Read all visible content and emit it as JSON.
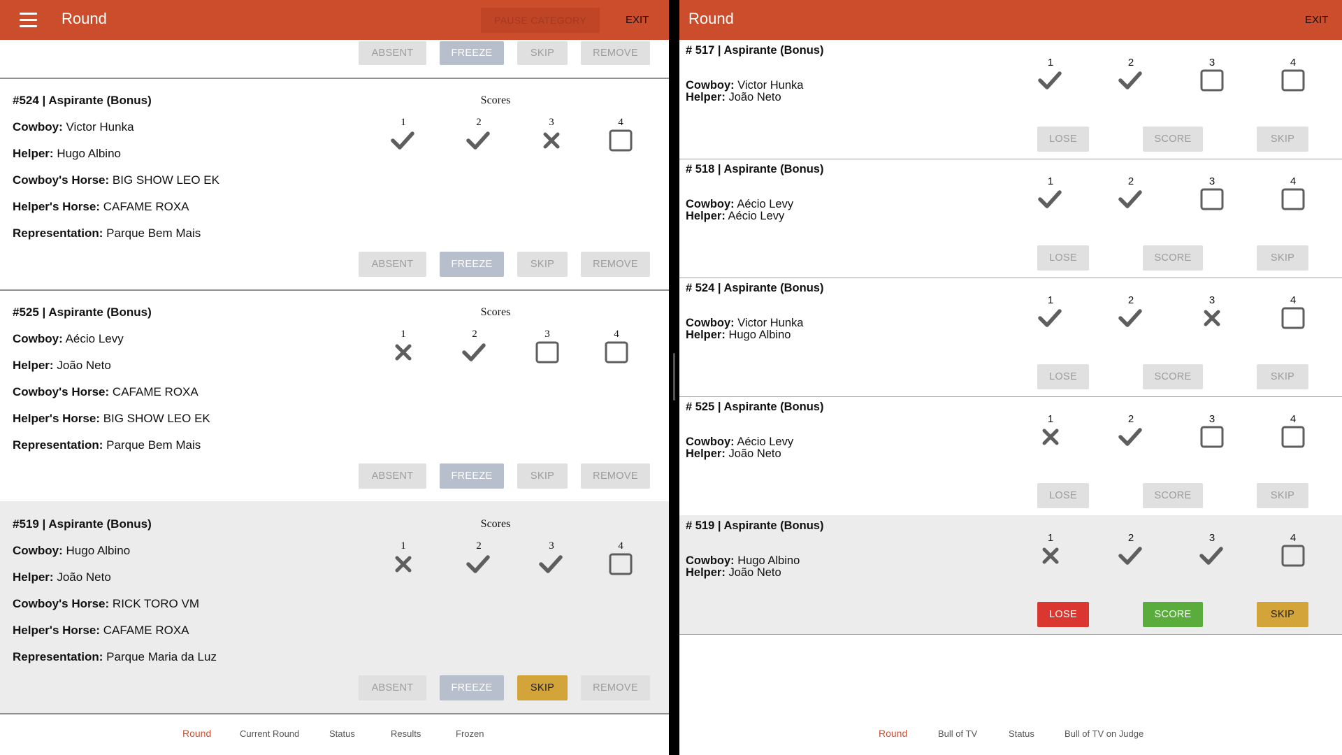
{
  "left": {
    "header": {
      "title": "Round",
      "pause_label": "PAUSE CATEGORY",
      "exit_label": "EXIT"
    },
    "top_actions": [
      "ABSENT",
      "FREEZE",
      "SKIP",
      "REMOVE"
    ],
    "scores_label": "Scores",
    "cards": [
      {
        "title": "#524 | Aspirante (Bonus)",
        "rows": [
          {
            "label": "Cowboy:",
            "value": "Victor Hunka"
          },
          {
            "label": "Helper:",
            "value": "Hugo Albino"
          },
          {
            "label": "Cowboy's Horse:",
            "value": "BIG SHOW LEO EK"
          },
          {
            "label": "Helper's Horse:",
            "value": "CAFAME ROXA"
          },
          {
            "label": "Representation:",
            "value": "Parque Bem Mais"
          }
        ],
        "scores": [
          {
            "num": "1",
            "state": "check"
          },
          {
            "num": "2",
            "state": "check"
          },
          {
            "num": "3",
            "state": "cross"
          },
          {
            "num": "4",
            "state": "empty"
          }
        ],
        "actions": [
          "ABSENT",
          "FREEZE",
          "SKIP",
          "REMOVE"
        ]
      },
      {
        "title": "#525 | Aspirante (Bonus)",
        "rows": [
          {
            "label": "Cowboy:",
            "value": "Aécio Levy"
          },
          {
            "label": "Helper:",
            "value": "João Neto"
          },
          {
            "label": "Cowboy's Horse:",
            "value": "CAFAME ROXA"
          },
          {
            "label": "Helper's Horse:",
            "value": "BIG SHOW LEO EK"
          },
          {
            "label": "Representation:",
            "value": "Parque Bem Mais"
          }
        ],
        "scores": [
          {
            "num": "1",
            "state": "cross"
          },
          {
            "num": "2",
            "state": "check"
          },
          {
            "num": "3",
            "state": "empty"
          },
          {
            "num": "4",
            "state": "empty"
          }
        ],
        "actions": [
          "ABSENT",
          "FREEZE",
          "SKIP",
          "REMOVE"
        ]
      },
      {
        "title": "#519 | Aspirante (Bonus)",
        "rows": [
          {
            "label": "Cowboy:",
            "value": "Hugo Albino"
          },
          {
            "label": "Helper:",
            "value": "João Neto"
          },
          {
            "label": "Cowboy's Horse:",
            "value": "RICK TORO VM"
          },
          {
            "label": "Helper's Horse:",
            "value": "CAFAME ROXA"
          },
          {
            "label": "Representation:",
            "value": "Parque Maria da Luz"
          }
        ],
        "scores": [
          {
            "num": "1",
            "state": "cross"
          },
          {
            "num": "2",
            "state": "check"
          },
          {
            "num": "3",
            "state": "check"
          },
          {
            "num": "4",
            "state": "empty"
          }
        ],
        "actions": [
          "ABSENT",
          "FREEZE",
          "SKIP",
          "REMOVE"
        ]
      }
    ],
    "footer_tabs": [
      "Round",
      "Current Round",
      "Status",
      "Results",
      "Frozen"
    ]
  },
  "right": {
    "header": {
      "title": "Round",
      "exit_label": "EXIT"
    },
    "cards": [
      {
        "title": "# 517 | Aspirante (Bonus)",
        "cowboy_label": "Cowboy:",
        "cowboy": "Victor Hunka",
        "helper_label": "Helper:",
        "helper": "João Neto",
        "scores": [
          {
            "num": "1",
            "state": "check"
          },
          {
            "num": "2",
            "state": "check"
          },
          {
            "num": "3",
            "state": "empty"
          },
          {
            "num": "4",
            "state": "empty"
          }
        ],
        "actions": [
          "LOSE",
          "SCORE",
          "SKIP"
        ]
      },
      {
        "title": "# 518 | Aspirante (Bonus)",
        "cowboy_label": "Cowboy:",
        "cowboy": "Aécio Levy",
        "helper_label": "Helper:",
        "helper": "Aécio Levy",
        "scores": [
          {
            "num": "1",
            "state": "check"
          },
          {
            "num": "2",
            "state": "check"
          },
          {
            "num": "3",
            "state": "empty"
          },
          {
            "num": "4",
            "state": "empty"
          }
        ],
        "actions": [
          "LOSE",
          "SCORE",
          "SKIP"
        ]
      },
      {
        "title": "# 524 | Aspirante (Bonus)",
        "cowboy_label": "Cowboy:",
        "cowboy": "Victor Hunka",
        "helper_label": "Helper:",
        "helper": "Hugo Albino",
        "scores": [
          {
            "num": "1",
            "state": "check"
          },
          {
            "num": "2",
            "state": "check"
          },
          {
            "num": "3",
            "state": "cross"
          },
          {
            "num": "4",
            "state": "empty"
          }
        ],
        "actions": [
          "LOSE",
          "SCORE",
          "SKIP"
        ]
      },
      {
        "title": "# 525 | Aspirante (Bonus)",
        "cowboy_label": "Cowboy:",
        "cowboy": "Aécio Levy",
        "helper_label": "Helper:",
        "helper": "João Neto",
        "scores": [
          {
            "num": "1",
            "state": "cross"
          },
          {
            "num": "2",
            "state": "check"
          },
          {
            "num": "3",
            "state": "empty"
          },
          {
            "num": "4",
            "state": "empty"
          }
        ],
        "actions": [
          "LOSE",
          "SCORE",
          "SKIP"
        ]
      },
      {
        "title": "# 519 | Aspirante (Bonus)",
        "cowboy_label": "Cowboy:",
        "cowboy": "Hugo Albino",
        "helper_label": "Helper:",
        "helper": "João Neto",
        "scores": [
          {
            "num": "1",
            "state": "cross"
          },
          {
            "num": "2",
            "state": "check"
          },
          {
            "num": "3",
            "state": "check"
          },
          {
            "num": "4",
            "state": "empty"
          }
        ],
        "actions": [
          "LOSE",
          "SCORE",
          "SKIP"
        ]
      }
    ],
    "footer_tabs": [
      "Round",
      "Bull of TV",
      "Status",
      "Bull of TV on Judge"
    ]
  },
  "colors": {
    "appbar": "#cc4d2c",
    "active_tab": "#cc4d2c",
    "lose_active": "#d9372f",
    "score_active": "#5aac3c",
    "skip_active": "#d3a43a",
    "freeze": "#b7bfcc",
    "selected_card": "#ececec"
  },
  "icons": {
    "check": "check-icon",
    "cross": "cross-icon",
    "empty": "empty-box-icon",
    "menu": "menu-icon"
  }
}
